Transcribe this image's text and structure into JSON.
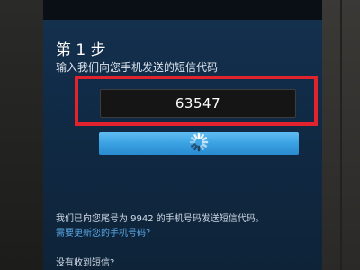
{
  "dialog": {
    "step_title": "第 1 步",
    "instruction": "输入我们向您手机发送的短信代码",
    "code_value": "63547",
    "sent_info": "我们已向您尾号为 9942 的手机号码发送短信代码。",
    "update_phone_link": "需要更新您的手机号码?",
    "no_code_text": "没有收到短信?"
  },
  "icons": {
    "submit_button_icon": "loading-spinner-icon"
  },
  "colors": {
    "dialog_background": "#14314f",
    "highlight_frame": "#e0232d",
    "button_blue": "#3aa1e2",
    "link_blue": "#59a8e8"
  }
}
